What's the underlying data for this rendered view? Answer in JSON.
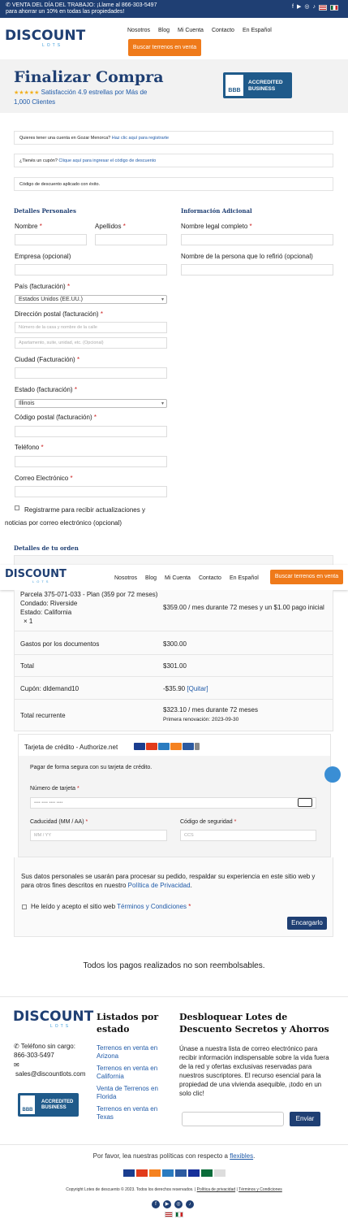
{
  "topbar": {
    "line1": "VENTA DEL DÍA DEL TRABAJO: ¡Llame al 866-303-5497",
    "line2": "para ahorrar un 10% en todas las propiedades!"
  },
  "logo": {
    "main": "DISCOUNT",
    "sub": "LOTS"
  },
  "nav": {
    "items": [
      "Nosotros",
      "Blog",
      "Mi Cuenta",
      "Contacto",
      "En Español"
    ],
    "cta": "Buscar terrenos en venta"
  },
  "hero": {
    "title": "Finalizar Compra",
    "rating": "★★★★★",
    "rating_text": "Satisfacción 4.9 estrellas por Más de",
    "rating_text2": "1,000 Clientes",
    "bbb_line1": "ACCREDITED",
    "bbb_line2": "BUSINESS",
    "bbb_mark": "BBB"
  },
  "notices": {
    "account_q": "Quieres tener una cuenta en Gozar Menorca?",
    "account_link": "Haz clic aquí para registrarte",
    "coupon_q": "¿Tienés un cupón?",
    "coupon_link": "Clique aquí para ingresar el código de descuento",
    "coupon_ok": "Código de descuento aplicado con éxito."
  },
  "personal": {
    "title": "Detalles Personales",
    "nombre": "Nombre",
    "apellidos": "Apellidos",
    "empresa": "Empresa  (opcional)",
    "pais": "País (facturación)",
    "pais_value": "Estados Unidos (EE.UU.)",
    "direccion": "Dirección postal (facturación)",
    "direccion_ph1": "Número de la casa y nombre de la calle",
    "direccion_ph2": "Apartamento, suite, unidad, etc. (Opcional)",
    "ciudad": "Ciudad (Facturación)",
    "estado": "Estado (facturación)",
    "estado_value": "Illinois",
    "cp": "Código postal (facturación)",
    "telefono": "Teléfono",
    "correo": "Correo Electrónico",
    "newsletter": "Registrarme para recibir actualizaciones y",
    "newsletter2": "noticias por correo electrónico (opcional)"
  },
  "additional": {
    "title": "Información Adicional",
    "legal": "Nombre legal completo",
    "referrer": "Nombre de la persona que lo refirió (opcional)"
  },
  "order": {
    "title": "Detalles de tu orden",
    "item_l1": "Parcela 375-071-033 - Plan (359 por 72 meses)",
    "item_l2": "Condado: Riverside",
    "item_l3": "Estado: California",
    "item_qty": "× 1",
    "item_price": "$359.00 / mes durante 72 meses y un $1.00 pago inicial",
    "doc_label": "Gastos por los documentos",
    "doc_value": "$300.00",
    "total_label": "Total",
    "total_value": "$301.00",
    "coupon_label": "Cupón: dldemand10",
    "coupon_value": "-$35.90",
    "coupon_remove": "[Quitar]",
    "recurring_label": "Total recurrente",
    "recurring_value": "$323.10 / mes durante 72 meses",
    "renewal": "Primera renovación: 2023-09-30"
  },
  "payment": {
    "method": "Tarjeta de crédito - Authorize.net",
    "secure": "Pagar de forma segura con su tarjeta de crédito.",
    "card_label": "Número de tarjeta",
    "card_ph": "•••• •••• •••• ••••",
    "exp_label": "Caducidad (MM / AA)",
    "exp_ph": "MM / YY",
    "cvc_label": "Código de seguridad",
    "cvc_ph": "CCS",
    "privacy": "Sus datos personales se usarán para procesar su pedido, respaldar su experiencia en este sitio web y para otros fines descritos en nuestro",
    "privacy_link": "Política de Privacidad",
    "terms": "He leído y acepto el sitio web",
    "terms_link": "Términos y Condiciones",
    "submit": "Encargarlo"
  },
  "nonrefund": "Todos los pagos realizados no son reembolsables.",
  "footer": {
    "phone": "Teléfono sin cargo:",
    "phone_num": "866-303-5497",
    "email": "sales@discountlots.com",
    "listings_title": "Listados por estado",
    "listings": [
      "Terrenos en venta en Arizona",
      "Terrenos en venta en California",
      "Venta de Terrenos en Florida",
      "Terrenos en venta en Texas"
    ],
    "unlock_title": "Desbloquear Lotes de Descuento Secretos y Ahorros",
    "unlock_text": "Únase a nuestra lista de correo electrónico para recibir información indispensable sobre la vida fuera de la red y ofertas exclusivas reservadas para nuestros suscriptores. El recurso esencial para la propiedad de una vivienda asequible, ¡todo en un solo clic!",
    "send": "Enviar",
    "policies": "Por favor, lea nuestras políticas con respecto a",
    "policies_link": "flexibles",
    "copyright": "Copyright Lotes de descuento © 2023. Todos los derechos reservados.",
    "privacy": "Política de privacidad",
    "terms": "Términos y Condiciones",
    "cards": [
      "VISA",
      "MC",
      "DISC",
      "AMEX",
      "DC",
      "PP",
      "JCB",
      "DISC"
    ]
  },
  "colors": {
    "navy": "#1f3f73",
    "orange": "#ef7a1a",
    "link": "#1f5aa8"
  }
}
